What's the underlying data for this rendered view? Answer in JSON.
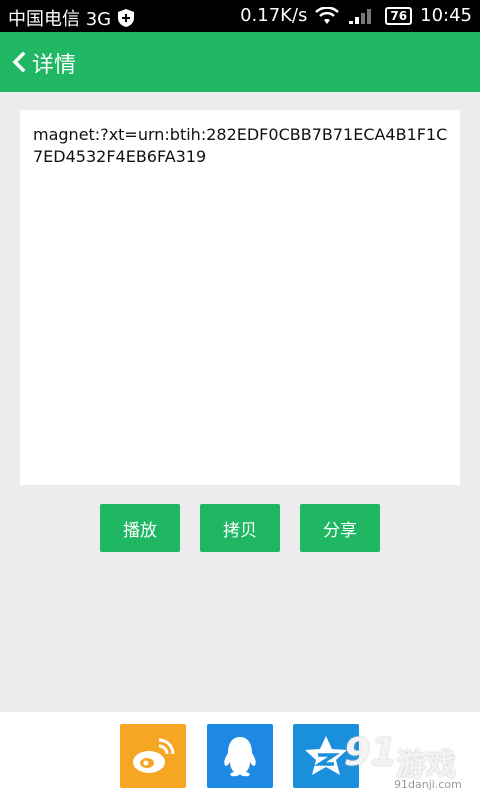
{
  "status_bar": {
    "carrier": "中国电信 3G",
    "speed": "0.17K/s",
    "battery": "76",
    "time": "10:45"
  },
  "app_bar": {
    "title": "详情",
    "back_icon": "chevron-left-icon"
  },
  "content": {
    "magnet_link": "magnet:?xt=urn:btih:282EDF0CBB7B71ECA4B1F1C7ED4532F4EB6FA319"
  },
  "actions": {
    "play_label": "播放",
    "copy_label": "拷贝",
    "share_label": "分享"
  },
  "share_targets": [
    {
      "name": "weibo",
      "icon": "weibo-icon",
      "color": "#f5a623"
    },
    {
      "name": "qq",
      "icon": "qq-icon",
      "color": "#1e88e5"
    },
    {
      "name": "qzone",
      "icon": "qzone-icon",
      "color": "#1a8fdc"
    }
  ],
  "watermark": {
    "number": "91",
    "text": "游戏",
    "site": "91danji.com"
  },
  "colors": {
    "primary": "#1fb764",
    "background": "#ececec"
  }
}
